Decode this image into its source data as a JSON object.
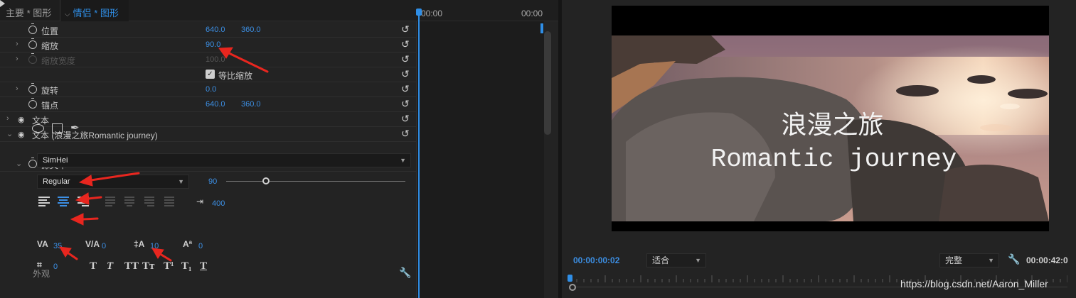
{
  "tabs": {
    "master": "主要 * 图形",
    "clip": "情侣 * 图形"
  },
  "timeline": {
    "time_start": "00:00",
    "time_end": "00:00"
  },
  "properties": [
    {
      "id": "position",
      "label": "位置",
      "v1": "640.0",
      "v2": "360.0"
    },
    {
      "id": "scale",
      "label": "缩放",
      "v1": "90.0"
    },
    {
      "id": "scale_width",
      "label": "缩放宽度",
      "v1": "100.0"
    },
    {
      "id": "uniform",
      "label": "等比缩放"
    },
    {
      "id": "rotation",
      "label": "旋转",
      "v1": "0.0"
    },
    {
      "id": "anchor",
      "label": "锚点",
      "v1": "640.0",
      "v2": "360.0"
    },
    {
      "id": "text_layer",
      "label": "文本"
    },
    {
      "id": "text_layer2",
      "label": "文本 (浪漫之旅Romantic journey)"
    },
    {
      "id": "source_text",
      "label": "源文本"
    }
  ],
  "text": {
    "font": "SimHei",
    "style": "Regular",
    "size": "90",
    "tab_width": "400",
    "tracking": "35",
    "kerning": "0",
    "leading": "10",
    "baseline_shift": "0",
    "tsume": "0",
    "appearance_label": "外观"
  },
  "font_style_buttons": [
    "T",
    "T",
    "TT",
    "Tт",
    "T¹",
    "T₁",
    "T"
  ],
  "monitor": {
    "title_cn": "浪漫之旅",
    "title_en": "Romantic journey",
    "timecode_current": "00:00:00:02",
    "fit": "适合",
    "quality": "完整",
    "timecode_duration": "00:00:42:0"
  },
  "watermark": "https://blog.csdn.net/Aaron_Miller",
  "colors": {
    "accent": "#2f8ee6",
    "annotation_arrow": "#e8261f"
  }
}
